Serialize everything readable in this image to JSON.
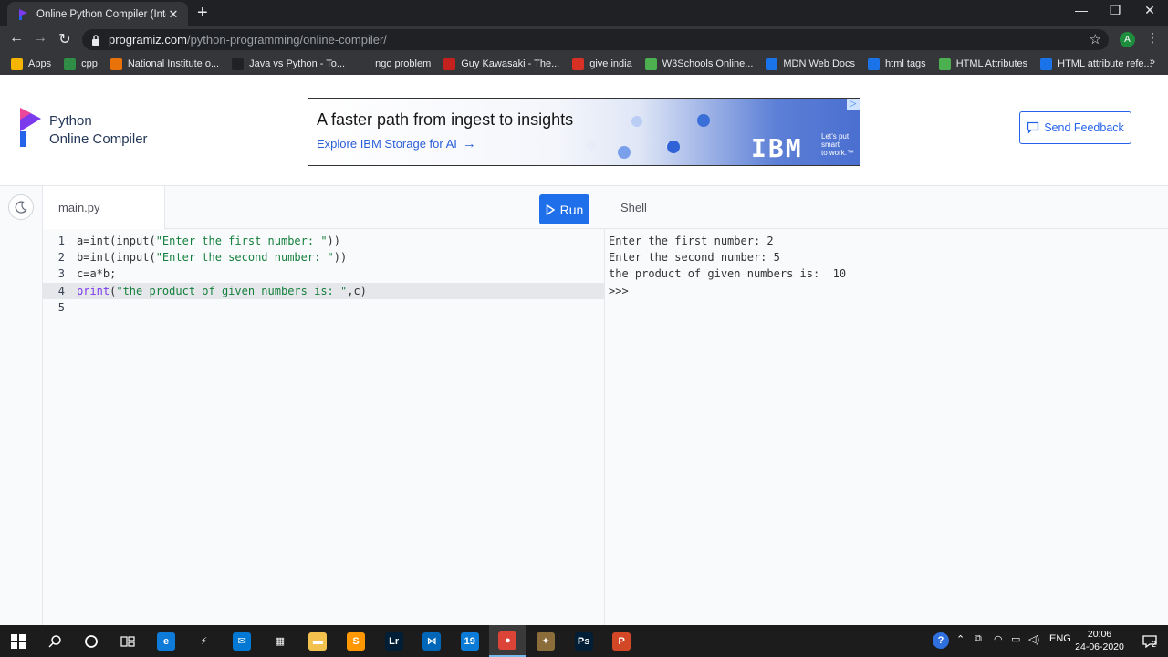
{
  "browser": {
    "tab_title": "Online Python Compiler (Interpre",
    "close": "✕",
    "new_tab": "+",
    "minimize": "—",
    "maximize": "❐",
    "close_window": "✕",
    "url_host": "programiz.com",
    "url_path": "/python-programming/online-compiler/",
    "profile_initial": "A",
    "bookmarks": [
      {
        "label": "Apps",
        "icon": "apps-grid-icon",
        "color": "#f4b400"
      },
      {
        "label": "cpp",
        "icon": "gfg-icon",
        "color": "#2f8d46"
      },
      {
        "label": "National Institute o...",
        "icon": "institute-icon",
        "color": "#e8710a"
      },
      {
        "label": "Java vs Python - To...",
        "icon": "java-icon",
        "color": "#202124"
      },
      {
        "label": "ngo problem",
        "icon": "medium-icon",
        "color": "#35363a"
      },
      {
        "label": "Guy Kawasaki - The...",
        "icon": "gk-icon",
        "color": "#c5221f"
      },
      {
        "label": "give india",
        "icon": "giveindia-icon",
        "color": "#d93025"
      },
      {
        "label": "W3Schools Online...",
        "icon": "w3schools-icon",
        "color": "#4caf50"
      },
      {
        "label": "MDN Web Docs",
        "icon": "mdn-icon",
        "color": "#1a73e8"
      },
      {
        "label": "html tags",
        "icon": "bookmark-icon",
        "color": "#1a73e8"
      },
      {
        "label": "HTML Attributes",
        "icon": "w3schools-icon",
        "color": "#4caf50"
      },
      {
        "label": "HTML attribute refe...",
        "icon": "bookmark-icon",
        "color": "#1a73e8"
      }
    ],
    "bookmarks_more": "»"
  },
  "header": {
    "logo_line1": "Python",
    "logo_line2": "Online Compiler",
    "ad_headline": "A faster path from ingest to insights",
    "ad_link": "Explore IBM Storage for AI",
    "ad_arrow": "→",
    "ad_brand": "IBM",
    "ad_tag_1": "Let’s put",
    "ad_tag_2": "smart",
    "ad_tag_3": "to work.™",
    "ad_badge": "▷",
    "feedback_label": "Send Feedback"
  },
  "editor": {
    "file_name": "main.py",
    "run_label": "Run",
    "active_line": 4,
    "lines": [
      {
        "n": "1",
        "parts": [
          {
            "t": "a=int(input(",
            "c": ""
          },
          {
            "t": "\"Enter the first number: \"",
            "c": "str"
          },
          {
            "t": "))",
            "c": ""
          }
        ]
      },
      {
        "n": "2",
        "parts": [
          {
            "t": "b=int(input(",
            "c": ""
          },
          {
            "t": "\"Enter the second number: \"",
            "c": "str"
          },
          {
            "t": "))",
            "c": ""
          }
        ]
      },
      {
        "n": "3",
        "parts": [
          {
            "t": "c=a*b;",
            "c": ""
          }
        ]
      },
      {
        "n": "4",
        "parts": [
          {
            "t": "print",
            "c": "kw"
          },
          {
            "t": "(",
            "c": ""
          },
          {
            "t": "\"the product of given numbers is: \"",
            "c": "str"
          },
          {
            "t": ",c)",
            "c": ""
          }
        ]
      },
      {
        "n": "5",
        "parts": []
      }
    ]
  },
  "shell": {
    "title": "Shell",
    "output": [
      "Enter the first number: 2",
      "Enter the second number: 5",
      "the product of given numbers is:  10",
      ">>>"
    ]
  },
  "taskbar": {
    "apps": [
      {
        "name": "edge",
        "label": "e",
        "color": "#0f7bd8"
      },
      {
        "name": "powershell",
        "label": "⚡",
        "color": "#1c1c1c"
      },
      {
        "name": "mail",
        "label": "✉",
        "color": "#0078d4"
      },
      {
        "name": "store",
        "label": "▦",
        "color": "#1c1c1c"
      },
      {
        "name": "explorer",
        "label": "▬",
        "color": "#f2c14e"
      },
      {
        "name": "sublime",
        "label": "S",
        "color": "#ff9800"
      },
      {
        "name": "lightroom",
        "label": "Lr",
        "color": "#001e36"
      },
      {
        "name": "vscode",
        "label": "⋈",
        "color": "#0066b8"
      },
      {
        "name": "app-19",
        "label": "19",
        "color": "#0a7bd6"
      },
      {
        "name": "chrome",
        "label": "●",
        "color": "#db4437"
      },
      {
        "name": "cs-game",
        "label": "✦",
        "color": "#8a6d3b"
      },
      {
        "name": "photoshop",
        "label": "Ps",
        "color": "#001e36"
      },
      {
        "name": "powerpoint",
        "label": "P",
        "color": "#d24726"
      }
    ],
    "lang": "ENG",
    "time": "20:06",
    "date": "24-06-2020",
    "notif_count": "2"
  }
}
